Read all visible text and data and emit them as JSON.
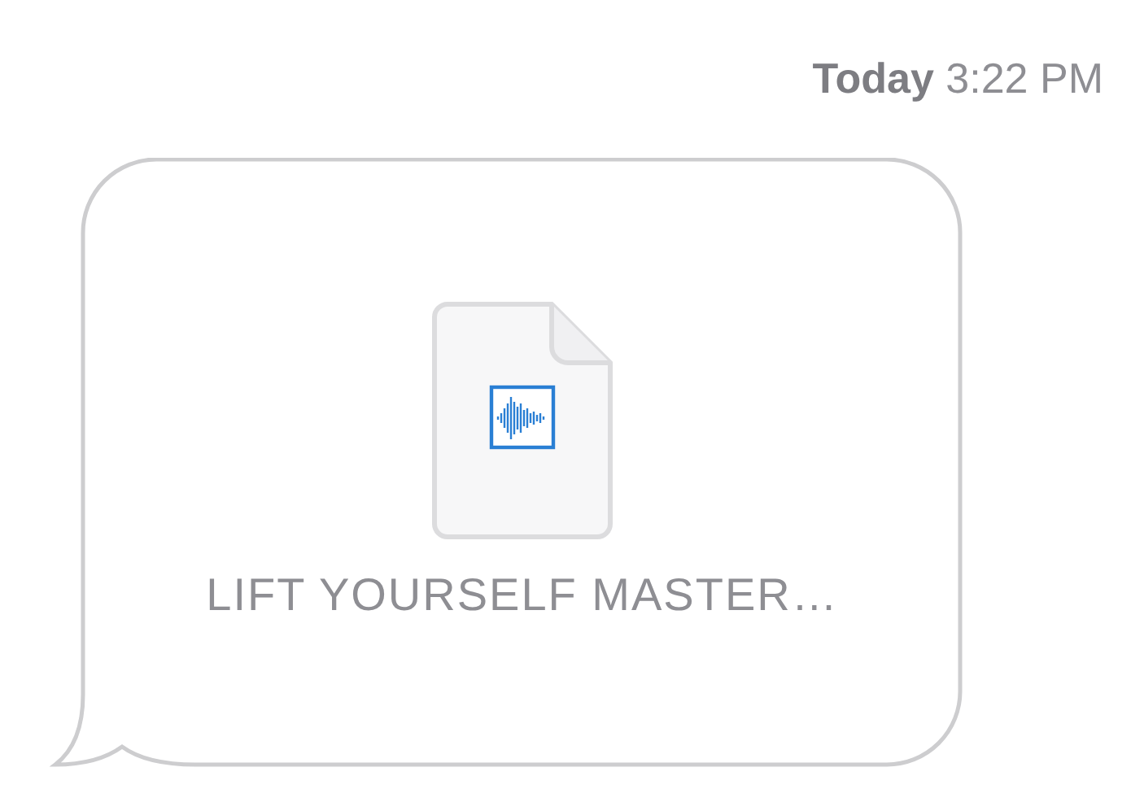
{
  "timestamp": "**Today** 3:22 PM",
  "message": {
    "attachment": {
      "kind": "audio",
      "filename": "LIFT YOURSELF MASTER…"
    }
  }
}
